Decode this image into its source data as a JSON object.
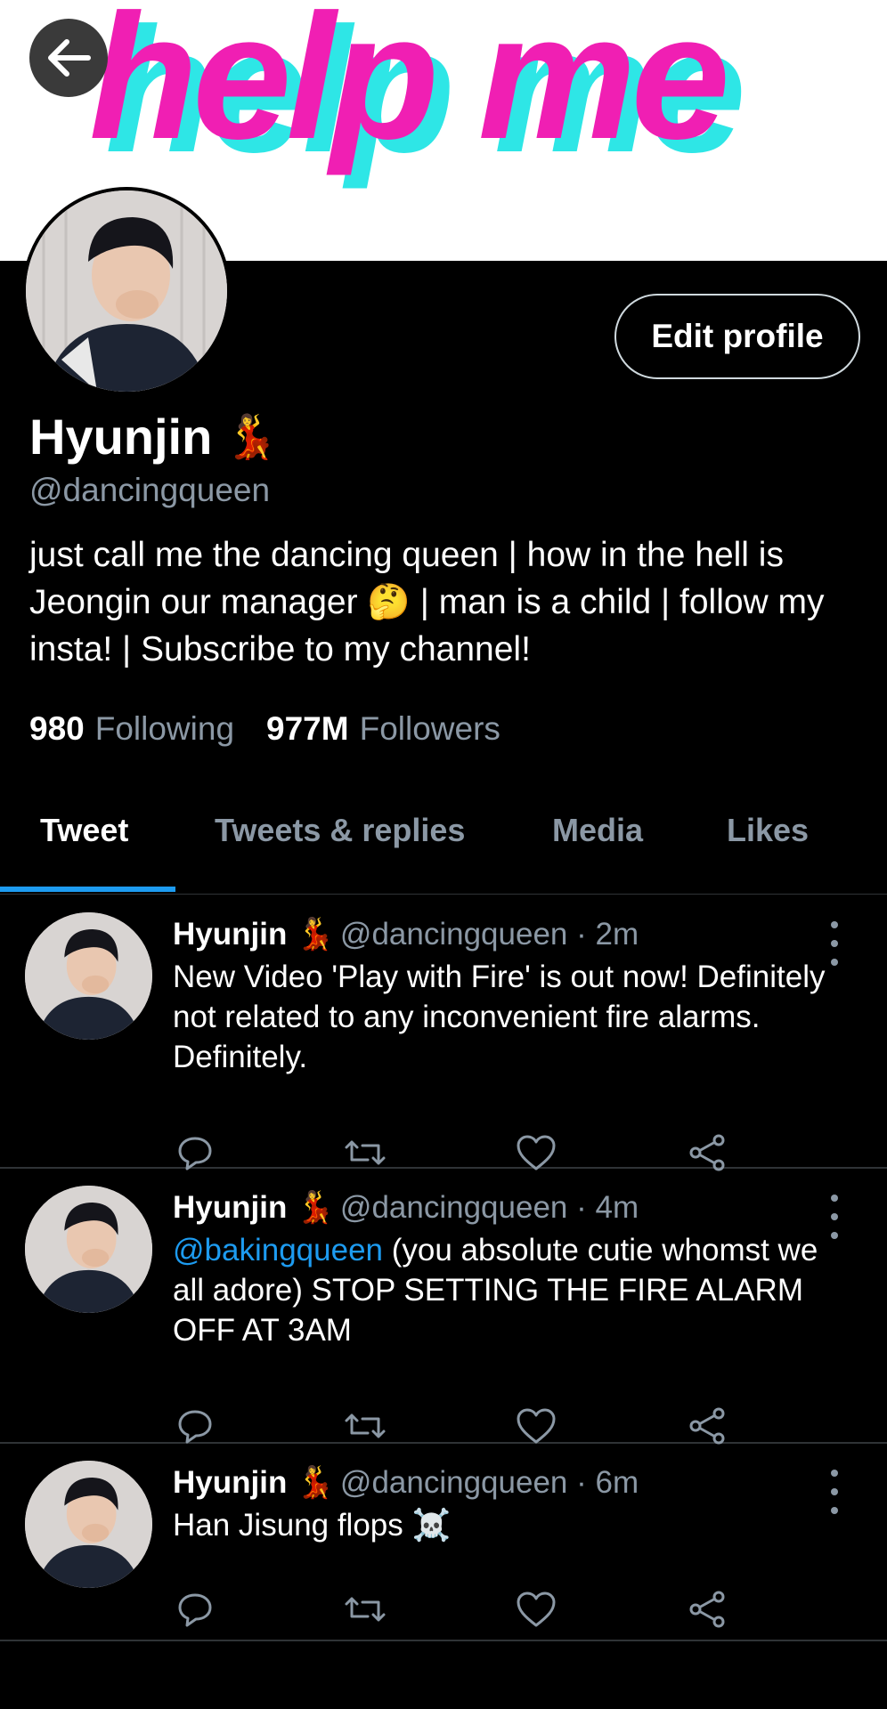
{
  "banner": {
    "text": "help me"
  },
  "header": {
    "back_label": "Back"
  },
  "profile": {
    "edit_label": "Edit profile",
    "name": "Hyunjin",
    "name_emoji": "💃",
    "handle": "@dancingqueen",
    "bio": "just call me the dancing queen | how in the hell is Jeongin our manager 🤔 | man is a child | follow my insta! | Subscribe to my channel!",
    "following_count": "980",
    "following_label": "Following",
    "followers_count": "977M",
    "followers_label": "Followers"
  },
  "tabs": [
    {
      "label": "Tweet",
      "active": true
    },
    {
      "label": "Tweets & replies",
      "active": false
    },
    {
      "label": "Media",
      "active": false
    },
    {
      "label": "Likes",
      "active": false
    }
  ],
  "tweets": [
    {
      "name": "Hyunjin",
      "emoji": "💃",
      "meta": "@dancingqueen · 2m",
      "mention": "",
      "text": "New Video 'Play with Fire' is out now! Definitely not related to any inconvenient fire alarms. Definitely."
    },
    {
      "name": "Hyunjin",
      "emoji": "💃",
      "meta": "@dancingqueen · 4m",
      "mention": "@bakingqueen",
      "text": " (you absolute cutie whomst we all adore) STOP SETTING THE FIRE ALARM OFF AT 3AM"
    },
    {
      "name": "Hyunjin",
      "emoji": "💃",
      "meta": "@dancingqueen · 6m",
      "mention": "",
      "text": "Han Jisung flops ☠️"
    }
  ],
  "colors": {
    "background": "#000000",
    "accent": "#1d9bf0",
    "secondary_text": "#8b98a5",
    "banner_magenta": "#f01fb3",
    "banner_cyan": "#2ee6e6"
  },
  "icons": [
    "back-arrow-icon",
    "reply-icon",
    "retweet-icon",
    "like-icon",
    "share-icon",
    "more-vertical-icon"
  ]
}
